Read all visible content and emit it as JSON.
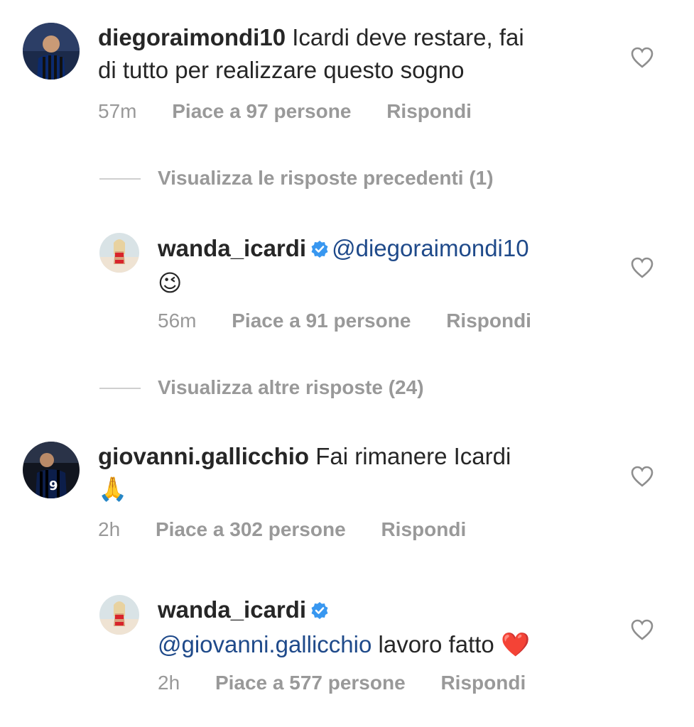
{
  "comments": [
    {
      "username": "diegoraimondi10",
      "text_line1": " Icardi deve restare, fai",
      "text_line2": "di tutto per realizzare questo sogno",
      "time": "57m",
      "likes": "Piace a 97 persone",
      "reply": "Rispondi"
    },
    {
      "username": "wanda_icardi",
      "mention": "@diegoraimondi10",
      "emoji": "😉",
      "time": "56m",
      "likes": "Piace a 91 persone",
      "reply": "Rispondi"
    },
    {
      "username": "giovanni.gallicchio",
      "text_line1": " Fai rimanere Icardi",
      "emoji": "🙏",
      "time": "2h",
      "likes": "Piace a 302 persone",
      "reply": "Rispondi"
    },
    {
      "username": "wanda_icardi",
      "mention": "@giovanni.gallicchio",
      "text_line2": " lavoro fatto ",
      "emoji": "❤️",
      "time": "2h",
      "likes": "Piace a 577 persone",
      "reply": "Rispondi"
    }
  ],
  "view_previous_replies": "Visualizza le risposte precedenti (1)",
  "view_more_replies": "Visualizza altre risposte (24)",
  "colors": {
    "text": "#262626",
    "meta": "#999999",
    "mention": "#1f4a8a",
    "verified": "#3897f0"
  },
  "icons": {
    "like": "heart-outline-icon",
    "verified": "verified-badge-icon"
  }
}
